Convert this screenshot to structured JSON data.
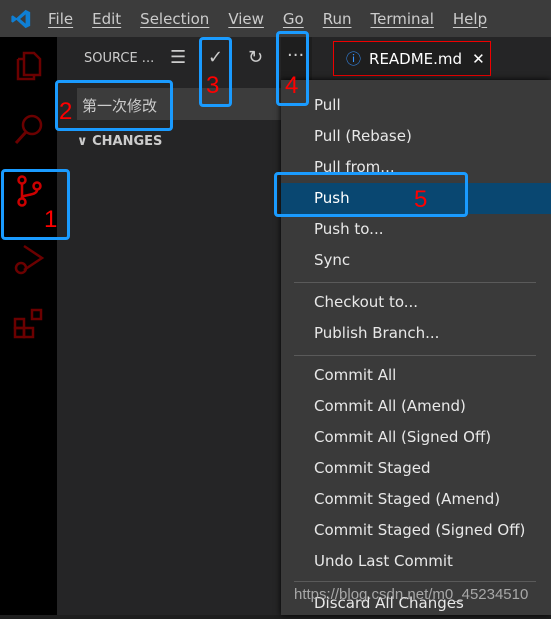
{
  "menubar": {
    "items": [
      "File",
      "Edit",
      "Selection",
      "View",
      "Go",
      "Run",
      "Terminal",
      "Help"
    ]
  },
  "sidebar": {
    "title": "SOURCE ...",
    "commit_message": "第一次修改",
    "changes_label": "CHANGES"
  },
  "tab": {
    "label": "README.md"
  },
  "context_menu": {
    "items": [
      "Pull",
      "Pull (Rebase)",
      "Pull from...",
      "Push",
      "Push to...",
      "Sync",
      "Checkout to...",
      "Publish Branch...",
      "Commit All",
      "Commit All (Amend)",
      "Commit All (Signed Off)",
      "Commit Staged",
      "Commit Staged (Amend)",
      "Commit Staged (Signed Off)",
      "Undo Last Commit",
      "Discard All Changes"
    ],
    "selected": "Push"
  },
  "annotations": [
    "1",
    "2",
    "3",
    "4",
    "5"
  ],
  "watermark": "https://blog.csdn.net/m0_45234510",
  "colors": {
    "accent": "#1a9bff",
    "annotation_text": "#ff0000",
    "selection": "#094771"
  }
}
